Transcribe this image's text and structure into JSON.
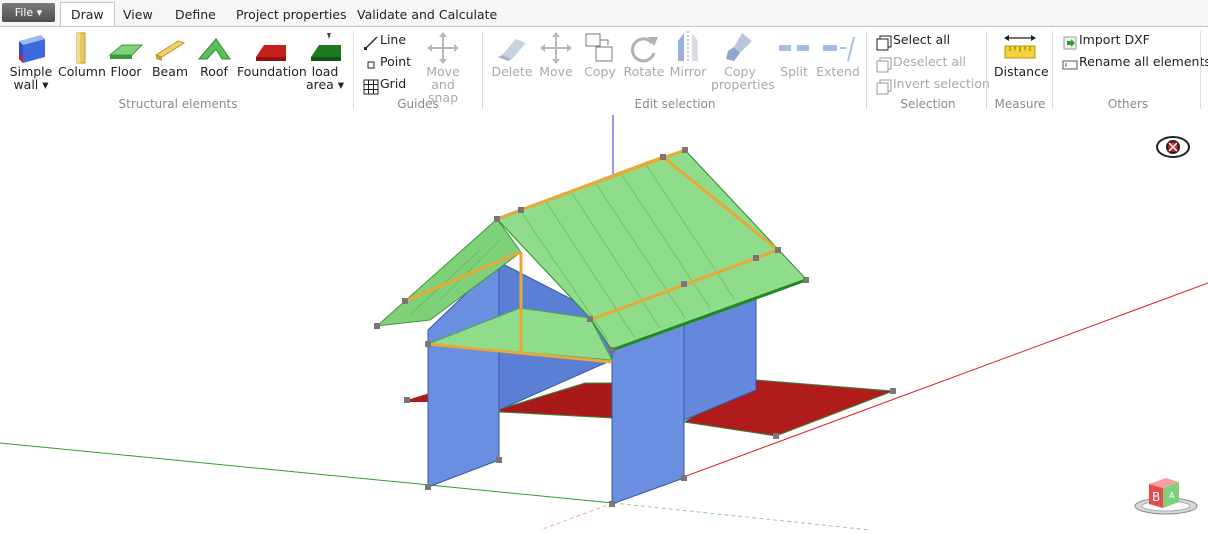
{
  "app": {
    "file_label": "File",
    "tabs": [
      {
        "label": "Draw",
        "active": true
      },
      {
        "label": "View",
        "active": false
      },
      {
        "label": "Define",
        "active": false
      },
      {
        "label": "Project properties",
        "active": false
      },
      {
        "label": "Validate and Calculate",
        "active": false
      }
    ]
  },
  "ribbon": {
    "structural": {
      "label": "Structural elements",
      "items": [
        "Simple\nwall ▾",
        "Column",
        "Floor",
        "Beam",
        "Roof",
        "Foundation",
        "load\narea ▾"
      ]
    },
    "guides": {
      "label": "Guides",
      "line": "Line",
      "point": "Point",
      "grid": "Grid",
      "move_snap": "Move and\nsnap"
    },
    "edit": {
      "label": "Edit selection",
      "items": [
        "Delete",
        "Move",
        "Copy",
        "Rotate",
        "Mirror",
        "Copy\nproperties",
        "Split",
        "Extend"
      ]
    },
    "selection": {
      "label": "Selection",
      "select_all": "Select all",
      "deselect_all": "Deselect all",
      "invert": "Invert selection"
    },
    "measure": {
      "label": "Measure",
      "distance": "Distance"
    },
    "others": {
      "label": "Others",
      "import_dxf": "Import DXF",
      "rename_all": "Rename all elements"
    }
  },
  "colors": {
    "wall": "#6b8fe0",
    "roof": "#8fdc8a",
    "beam": "#e8a838",
    "foundation": "#b01c1c",
    "axis_x": "#e02020",
    "axis_y": "#2aa02a",
    "axis_z": "#3030e0"
  },
  "viewport": {
    "icons": [
      "visibility-toggle-icon",
      "view-cube-icon"
    ]
  }
}
